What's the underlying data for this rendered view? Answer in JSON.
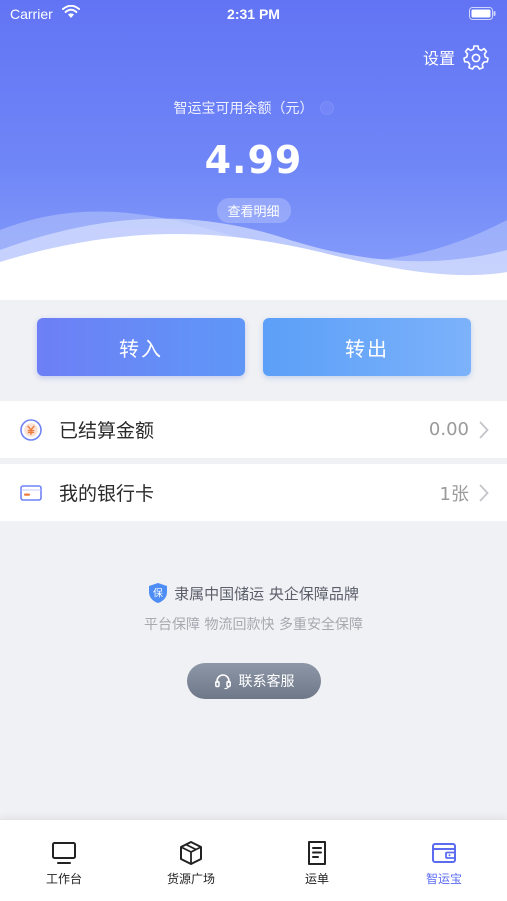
{
  "status_bar": {
    "carrier": "Carrier",
    "time": "2:31 PM"
  },
  "header": {
    "settings_label": "设置",
    "balance_label": "智运宝可用余额（元）",
    "balance": "4.99",
    "detail_label": "查看明细"
  },
  "actions": {
    "transfer_in": "转入",
    "transfer_out": "转出"
  },
  "list": [
    {
      "label": "已结算金额",
      "value": "0.00",
      "icon": "yen-coin-icon"
    },
    {
      "label": "我的银行卡",
      "value": "1张",
      "icon": "bank-card-icon"
    }
  ],
  "trust": {
    "badge_char": "保",
    "headline": "隶属中国储运 央企保障品牌",
    "subline": "平台保障 物流回款快 多重安全保障",
    "service_label": "联系客服"
  },
  "tabs": [
    {
      "label": "工作台",
      "icon": "monitor-icon",
      "active": false
    },
    {
      "label": "货源广场",
      "icon": "cube-icon",
      "active": false
    },
    {
      "label": "运单",
      "icon": "document-icon",
      "active": false
    },
    {
      "label": "智运宝",
      "icon": "wallet-icon",
      "active": true
    }
  ],
  "colors": {
    "accent": "#5b6cf0",
    "header_top": "#6274f4",
    "header_bottom": "#8aa1fb"
  }
}
